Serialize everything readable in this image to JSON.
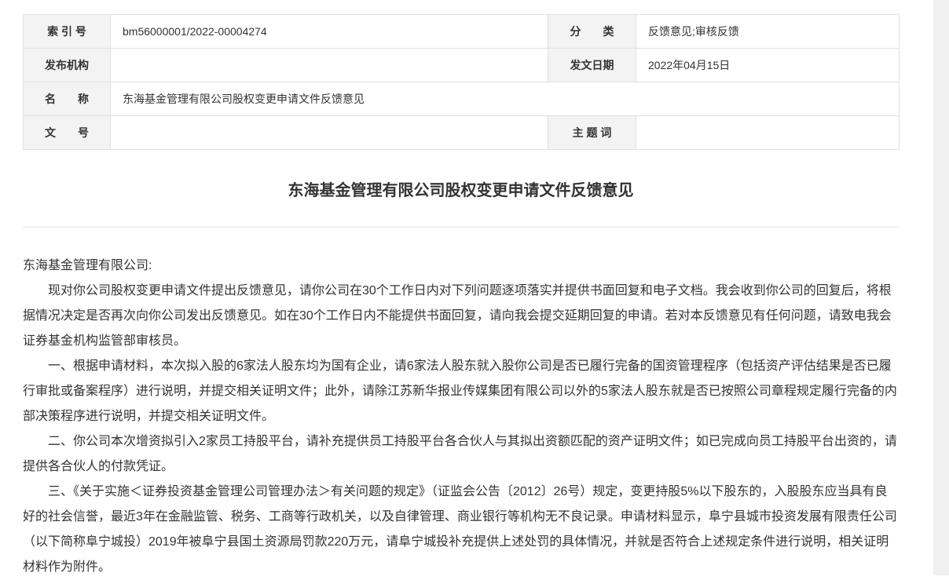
{
  "meta": {
    "index_label": "索 引 号",
    "index_value": "bm56000001/2022-00004274",
    "category_label": "分　　类",
    "category_value": "反馈意见;审核反馈",
    "issuer_label": "发布机构",
    "issuer_value": "",
    "date_label": "发文日期",
    "date_value": "2022年04月15日",
    "name_label": "名　　称",
    "name_value": "东海基金管理有限公司股权变更申请文件反馈意见",
    "docno_label": "文　　号",
    "docno_value": "",
    "keywords_label": "主 题 词",
    "keywords_value": ""
  },
  "document": {
    "title": "东海基金管理有限公司股权变更申请文件反馈意见",
    "salutation": "东海基金管理有限公司:",
    "paragraphs": [
      "现对你公司股权变更申请文件提出反馈意见，请你公司在30个工作日内对下列问题逐项落实并提供书面回复和电子文档。我会收到你公司的回复后，将根据情况决定是否再次向你公司发出反馈意见。如在30个工作日内不能提供书面回复，请向我会提交延期回复的申请。若对本反馈意见有任何问题，请致电我会证券基金机构监管部审核员。",
      "一、根据申请材料，本次拟入股的6家法人股东均为国有企业，请6家法人股东就入股你公司是否已履行完备的国资管理程序（包括资产评估结果是否已履行审批或备案程序）进行说明，并提交相关证明文件；此外，请除江苏新华报业传媒集团有限公司以外的5家法人股东就是否已按照公司章程规定履行完备的内部决策程序进行说明，并提交相关证明文件。",
      "二、你公司本次增资拟引入2家员工持股平台，请补充提供员工持股平台各合伙人与其拟出资额匹配的资产证明文件；如已完成向员工持股平台出资的，请提供各合伙人的付款凭证。",
      "三、《关于实施＜证券投资基金管理公司管理办法＞有关问题的规定》（证监会公告〔2012〕26号）规定，变更持股5%以下股东的，入股股东应当具有良好的社会信誉，最近3年在金融监管、税务、工商等行政机关，以及自律管理、商业银行等机构无不良记录。申请材料显示，阜宁县城市投资发展有限责任公司（以下简称阜宁城投）2019年被阜宁县国土资源局罚款220万元，请阜宁城投补充提供上述处罚的具体情况，并就是否符合上述规定条件进行说明，相关证明材料作为附件。"
    ]
  }
}
